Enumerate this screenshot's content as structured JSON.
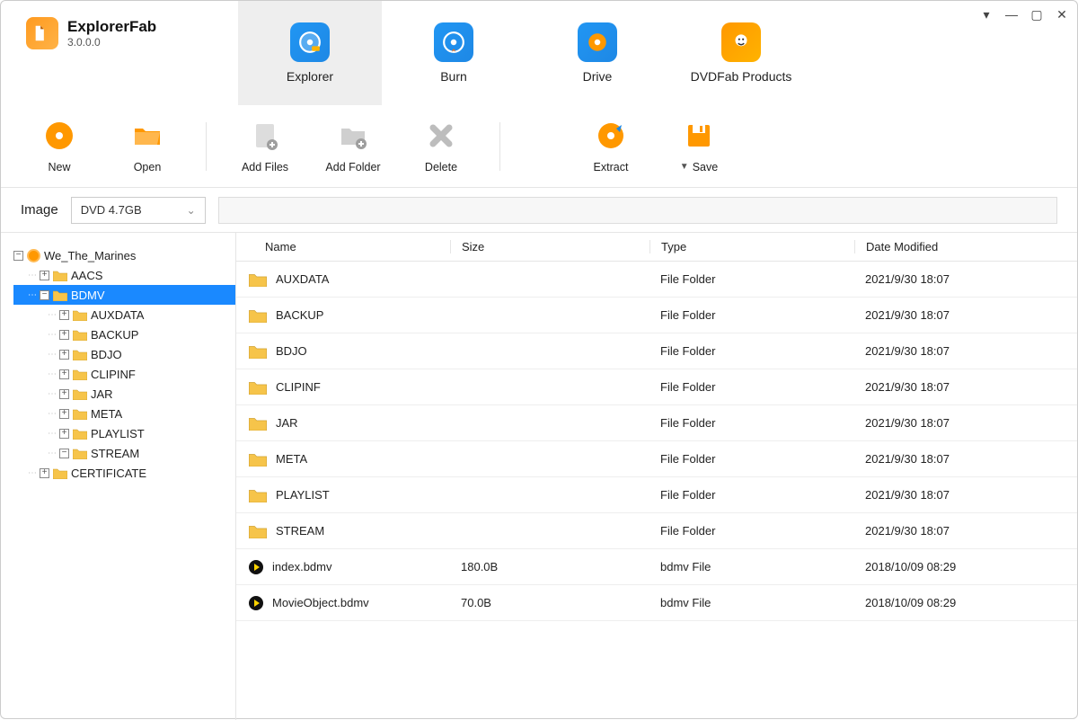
{
  "app": {
    "title": "ExplorerFab",
    "version": "3.0.0.0"
  },
  "tabs": {
    "explorer": "Explorer",
    "burn": "Burn",
    "drive": "Drive",
    "products": "DVDFab Products"
  },
  "toolbar": {
    "new": "New",
    "open": "Open",
    "addFiles": "Add Files",
    "addFolder": "Add Folder",
    "delete": "Delete",
    "extract": "Extract",
    "save": "Save"
  },
  "imageRow": {
    "label": "Image",
    "selected": "DVD 4.7GB"
  },
  "tree": {
    "root": "We_The_Marines",
    "aacs": "AACS",
    "bdmv": "BDMV",
    "bdmvChildren": [
      "AUXDATA",
      "BACKUP",
      "BDJO",
      "CLIPINF",
      "JAR",
      "META",
      "PLAYLIST",
      "STREAM"
    ],
    "certificate": "CERTIFICATE"
  },
  "columns": {
    "name": "Name",
    "size": "Size",
    "type": "Type",
    "date": "Date Modified"
  },
  "files": [
    {
      "name": "AUXDATA",
      "size": "",
      "type": "File Folder",
      "date": "2021/9/30 18:07",
      "icon": "folder"
    },
    {
      "name": "BACKUP",
      "size": "",
      "type": "File Folder",
      "date": "2021/9/30 18:07",
      "icon": "folder"
    },
    {
      "name": "BDJO",
      "size": "",
      "type": "File Folder",
      "date": "2021/9/30 18:07",
      "icon": "folder"
    },
    {
      "name": "CLIPINF",
      "size": "",
      "type": "File Folder",
      "date": "2021/9/30 18:07",
      "icon": "folder"
    },
    {
      "name": "JAR",
      "size": "",
      "type": "File Folder",
      "date": "2021/9/30 18:07",
      "icon": "folder"
    },
    {
      "name": "META",
      "size": "",
      "type": "File Folder",
      "date": "2021/9/30 18:07",
      "icon": "folder"
    },
    {
      "name": "PLAYLIST",
      "size": "",
      "type": "File Folder",
      "date": "2021/9/30 18:07",
      "icon": "folder"
    },
    {
      "name": "STREAM",
      "size": "",
      "type": "File Folder",
      "date": "2021/9/30 18:07",
      "icon": "folder"
    },
    {
      "name": "index.bdmv",
      "size": "180.0B",
      "type": "bdmv File",
      "date": "2018/10/09 08:29",
      "icon": "bdmv"
    },
    {
      "name": "MovieObject.bdmv",
      "size": "70.0B",
      "type": "bdmv File",
      "date": "2018/10/09 08:29",
      "icon": "bdmv"
    }
  ]
}
